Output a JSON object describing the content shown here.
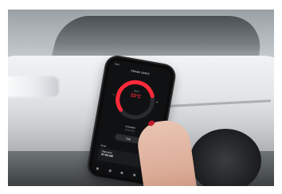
{
  "app": {
    "screen_title": "Climate control",
    "status_time": "9:41",
    "set_label": "Set to",
    "temperature": "23°C",
    "minus_label": "−",
    "plus_label": "+",
    "state_label": "Activated",
    "state_sub": "Until 09:55",
    "stop_label": "Stop",
    "timer_label": "Timer",
    "timer_card_title": "Departure",
    "timer_card_time": "07:30 AM",
    "accent_color": "#ff2a3a",
    "toggle_color": "#2fc25a",
    "tab_icons": [
      "home-icon",
      "climate-icon",
      "map-icon",
      "car-icon",
      "settings-icon"
    ],
    "dial_level": 0.75
  }
}
